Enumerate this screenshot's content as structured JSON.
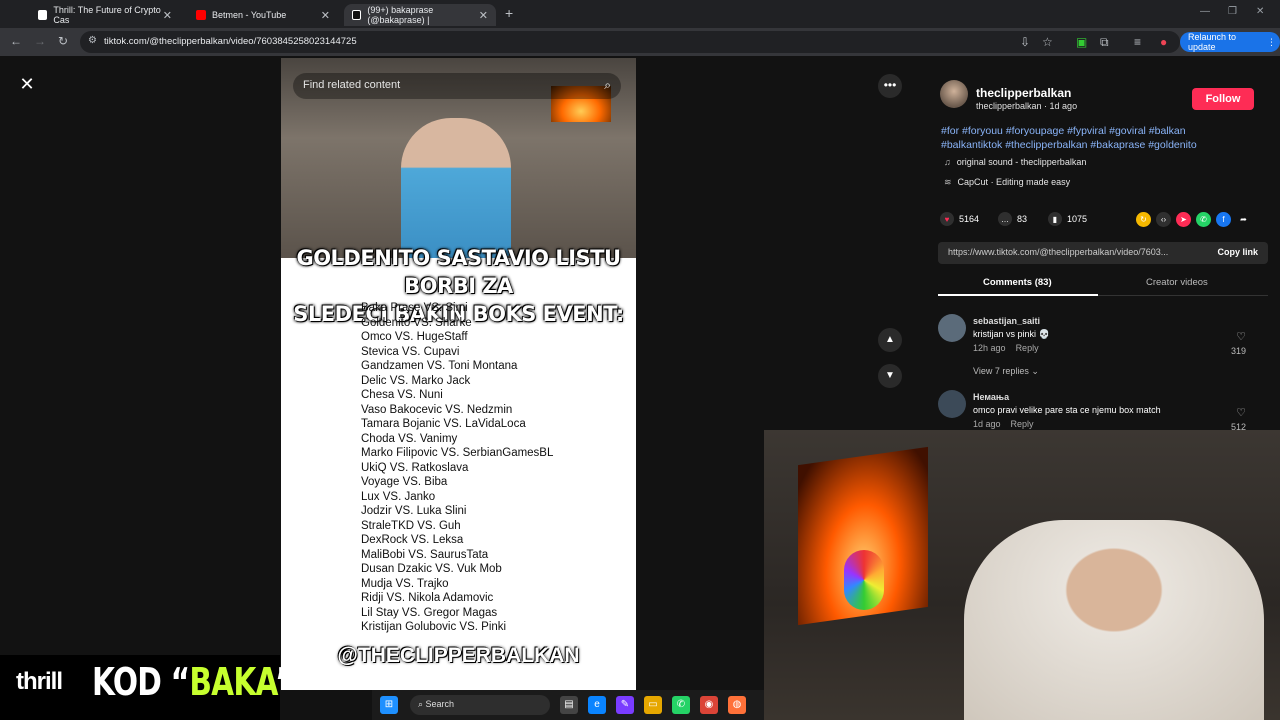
{
  "tabs": [
    {
      "title": "Thrill: The Future of Crypto Cas",
      "color": "#ffffff"
    },
    {
      "title": "Betmen - YouTube",
      "color": "#ff0000"
    },
    {
      "title": "(99+) bakaprase (@bakaprase) |",
      "color": "#ffffff"
    }
  ],
  "toolbar": {
    "url": "tiktok.com/@theclipperbalkan/video/7603845258023144725",
    "relaunch_label": "Relaunch to update"
  },
  "video": {
    "search_placeholder": "Find related content",
    "headline_lines": [
      "GOLDENITO SASTAVIO LISTU BORBI ZA",
      "SLEDECI BAKIN BOKS EVENT:"
    ],
    "matches": [
      "Baka Prase VS. Simi",
      "Goldenito VS. Sharke",
      "Omco VS. HugeStaff",
      "Stevica VS. Cupavi",
      "Gandzamen VS. Toni Montana",
      "Delic VS. Marko Jack",
      "Chesa VS. Nuni",
      "Vaso Bakocevic VS. Nedzmin",
      "Tamara Bojanic VS. LaVidaLoca",
      "Choda VS. Vanimy",
      "Marko Filipovic VS. SerbianGamesBL",
      "UkiQ VS. Ratkoslava",
      "Voyage VS. Biba",
      "Lux VS. Janko",
      "Jodzir VS. Luka Slini",
      "StraleTKD VS. Guh",
      "DexRock VS. Leksa",
      "MaliBobi VS. SaurusTata",
      "Dusan Dzakic VS. Vuk Mob",
      "Mudja VS. Trajko",
      "Ridji VS. Nikola Adamovic",
      "Lil Stay VS. Gregor Magas",
      "Kristijan Golubovic VS. Pinki"
    ],
    "watermark": "@THECLIPPERBALKAN"
  },
  "panel": {
    "username": "theclipperbalkan",
    "meta": "theclipperbalkan · 1d ago",
    "follow_label": "Follow",
    "hashtags": "#for #foryouu #foryoupage #fypviral #goviral #balkan #balkantiktok #theclipperbalkan #bakaprase #goldenito",
    "sound": "original sound - theclipperbalkan",
    "capcut": "CapCut · Editing made easy",
    "likes": "5164",
    "comments_count": "83",
    "saves": "1075",
    "link": "https://www.tiktok.com/@theclipperbalkan/video/7603...",
    "copy_label": "Copy link",
    "tab_comments": "Comments (83)",
    "tab_creator": "Creator videos",
    "comments": [
      {
        "user": "sebastijan_saiti",
        "text": "kristijan vs pinki 💀",
        "time": "12h ago",
        "reply": "Reply",
        "likes": "319"
      },
      {
        "user": "Немања",
        "text": "omco pravi velike pare sta ce njemu box match",
        "time": "1d ago",
        "reply": "Reply",
        "likes": "512"
      }
    ],
    "view_replies": "View 7 replies"
  },
  "overlay": {
    "brand": "thrill",
    "kod_prefix": "KOD “",
    "kod_accent": "BAKA",
    "kod_suffix": "”",
    "accent_color": "#c6ff2e"
  },
  "taskbar": {
    "search_label": "Search"
  }
}
